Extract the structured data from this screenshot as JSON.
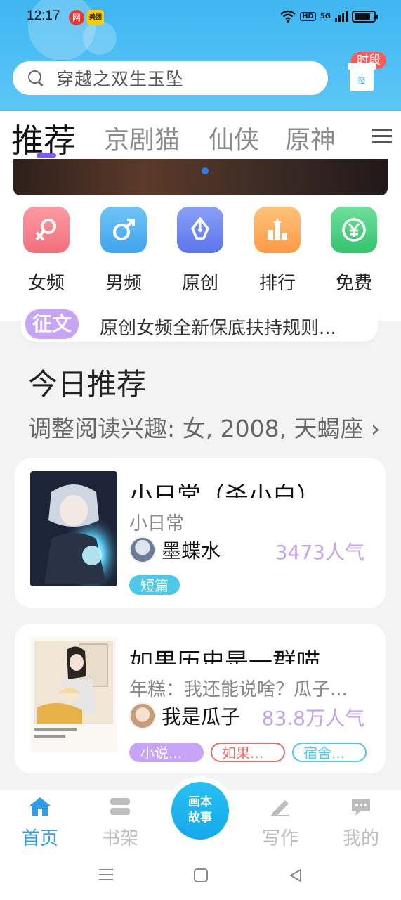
{
  "status_bar": {
    "time": "12:17",
    "app_icon_1": "网",
    "app_icon_2": "美团",
    "hd_label": "HD",
    "network_label": "5G"
  },
  "search": {
    "placeholder_text": "穿越之双生玉坠"
  },
  "gift": {
    "tag_label": "时段",
    "box_label": "签"
  },
  "tabs": [
    "推荐",
    "京剧猫",
    "仙侠",
    "原神"
  ],
  "categories": [
    {
      "label": "女频",
      "icon": "female-icon",
      "symbol": "♀",
      "color": "#f27a86"
    },
    {
      "label": "男频",
      "icon": "male-icon",
      "symbol": "♂",
      "color": "#4fb1f1"
    },
    {
      "label": "原创",
      "icon": "pen-nib-icon",
      "symbol": "✒",
      "color": "#6d86f0"
    },
    {
      "label": "排行",
      "icon": "ranking-icon",
      "symbol": "▇",
      "color": "#ffad5a"
    },
    {
      "label": "免费",
      "icon": "yen-icon",
      "symbol": "¥",
      "color": "#4ad07f"
    }
  ],
  "notice": {
    "badge": "征文",
    "text": "原创女频全新保底扶持规则..."
  },
  "today": {
    "title": "今日推荐",
    "subtitle": "调整阅读兴趣: 女, 2008, 天蝎座 ›"
  },
  "cards": [
    {
      "title": "小日常（杀小白）",
      "desc": "小日常",
      "author": "墨蝶水",
      "popularity": "3473人气",
      "tags": [
        {
          "label": "短篇",
          "color": "#4fc7e8",
          "filled": true
        }
      ]
    },
    {
      "title": "如果历史是一群喵",
      "desc": "年糕：我还能说啥？瓜子...",
      "author": "我是瓜子",
      "popularity": "83.8万人气",
      "tags": [
        {
          "label": "小说...",
          "color": "#c7a4f5",
          "filled": true
        },
        {
          "label": "如果...",
          "color": "#e86a6a",
          "filled": false
        },
        {
          "label": "宿舍...",
          "color": "#4fc7e8",
          "filled": false
        }
      ]
    }
  ],
  "bottom_nav": {
    "home": "首页",
    "shelf": "书架",
    "center": "画本故事",
    "center_line1": "画本",
    "center_line2": "故事",
    "write": "写作",
    "mine": "我的"
  },
  "colors": {
    "header": "#3fb6f2",
    "accent": "#2d9ee8",
    "tab_indicator": "#7a5cf0"
  }
}
